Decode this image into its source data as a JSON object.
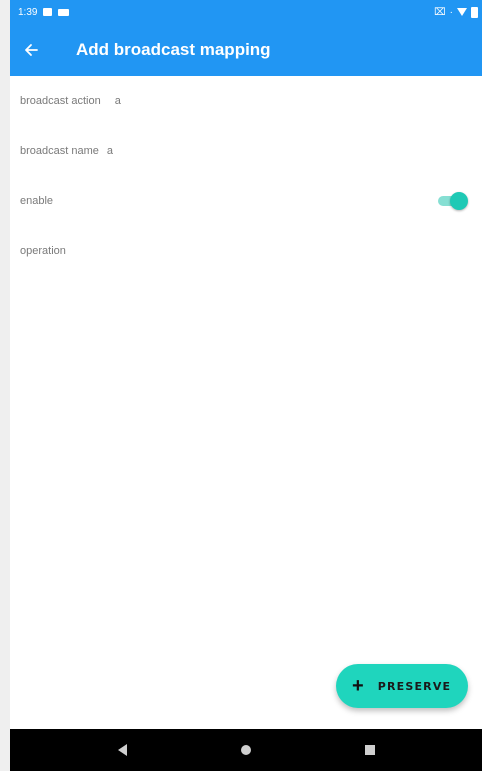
{
  "status_bar": {
    "time": "1:39",
    "left_icons": [
      "photo-icon",
      "message-icon"
    ],
    "right_icons": [
      "no-sim-icon",
      "wifi-icon",
      "battery-icon"
    ],
    "signal_text": "·"
  },
  "app_bar": {
    "title": "Add broadcast mapping",
    "back_icon": "arrow-left-icon",
    "color": "#2196f3"
  },
  "form": {
    "broadcast_action": {
      "label": "broadcast action",
      "value": "a"
    },
    "broadcast_name": {
      "label": "broadcast name",
      "value": "a"
    },
    "enable": {
      "label": "enable",
      "checked": true
    },
    "operation": {
      "label": "operation",
      "value": ""
    }
  },
  "fab": {
    "icon": "plus-icon",
    "label": "PRESERVE",
    "color": "#1fd5bd"
  },
  "nav_bar": {
    "buttons": [
      "back-triangle-icon",
      "home-circle-icon",
      "recents-square-icon"
    ]
  },
  "accent": "#1fc9b5"
}
